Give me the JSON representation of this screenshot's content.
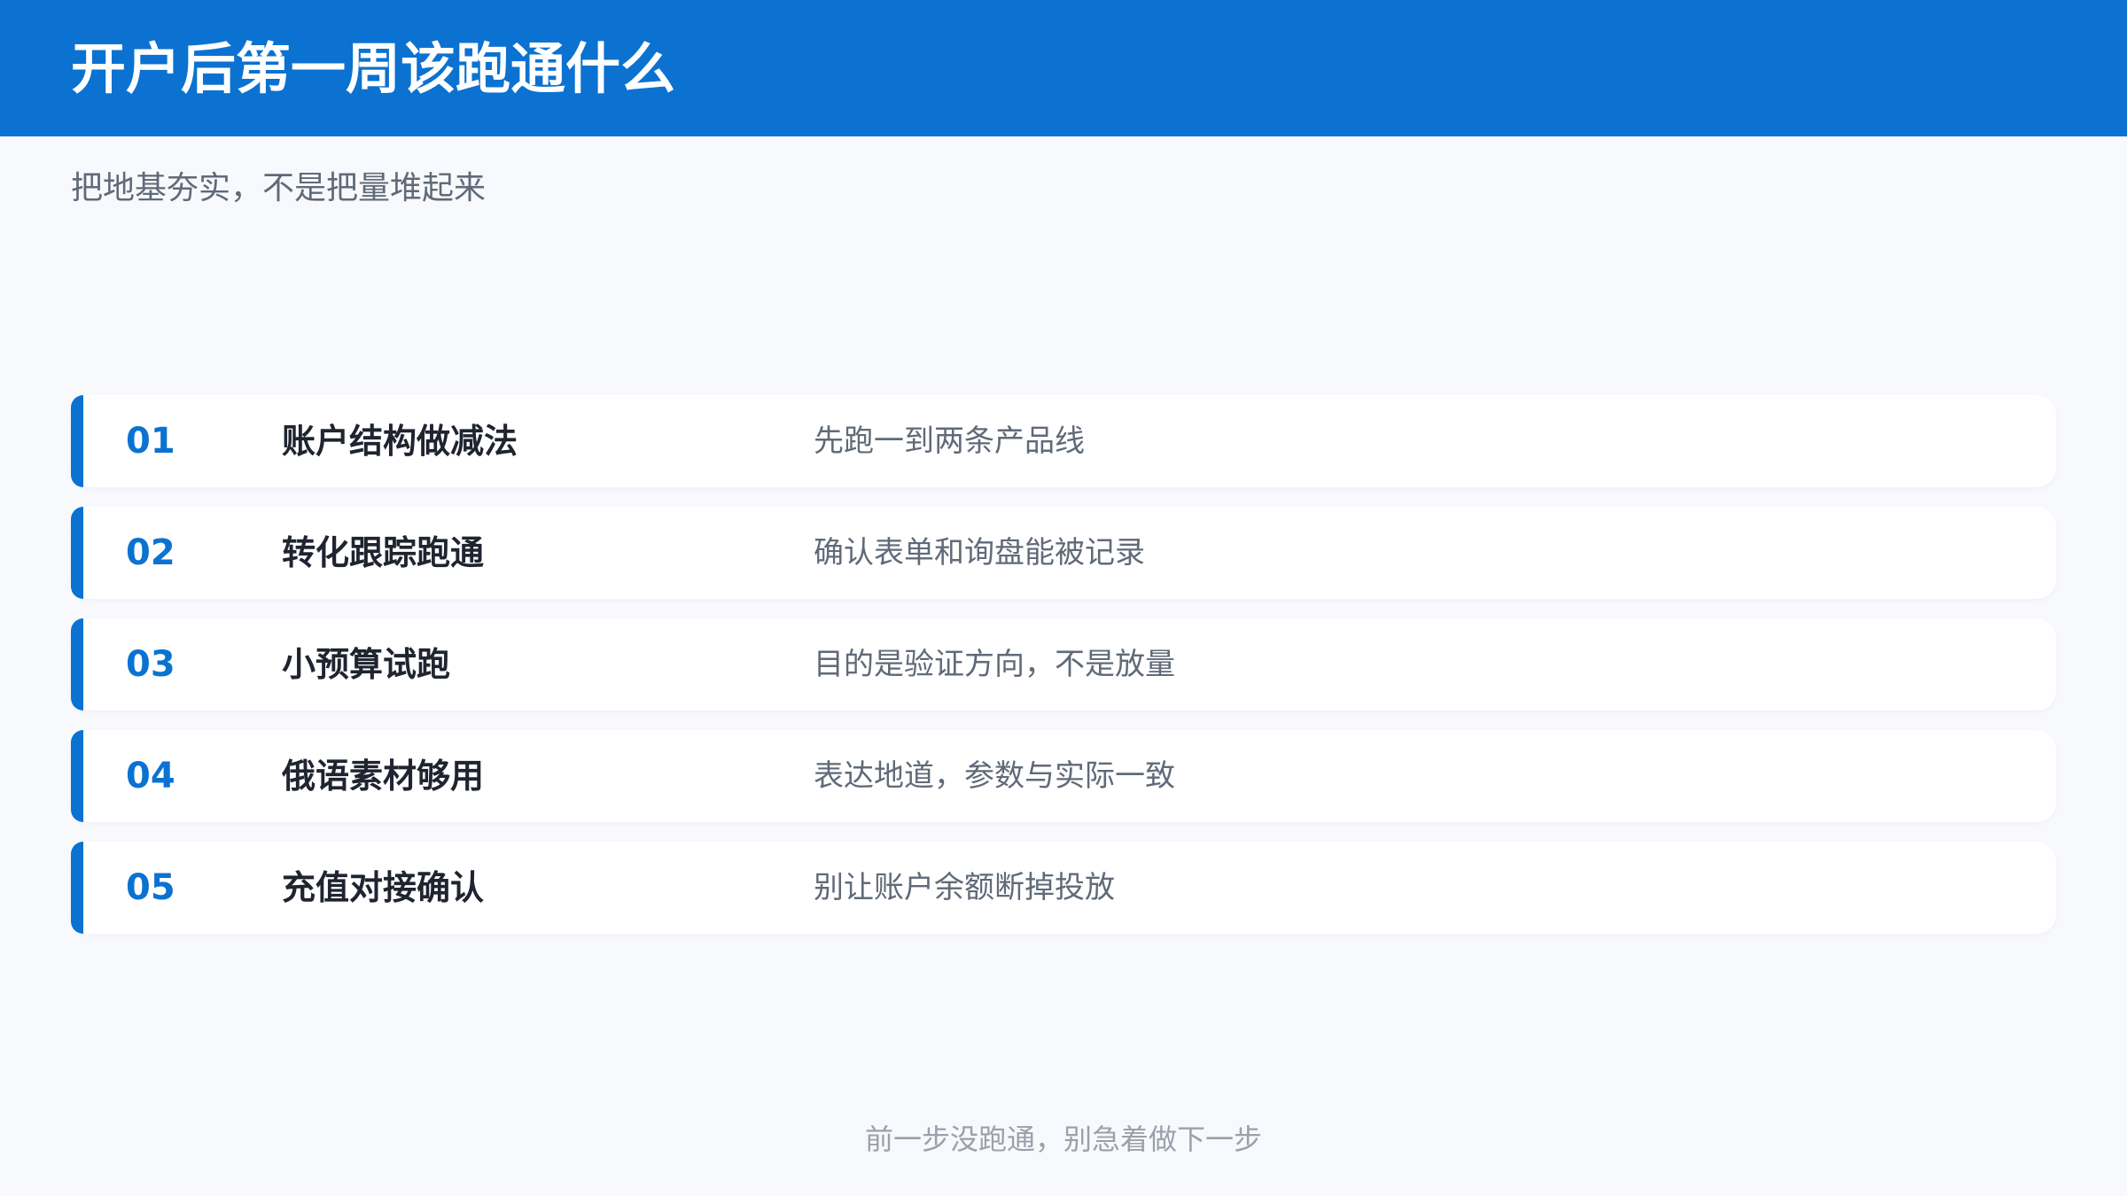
{
  "header": {
    "title": "开户后第一周该跑通什么",
    "accent_color": "#0b72d1"
  },
  "subtitle": "把地基夯实，不是把量堆起来",
  "items": [
    {
      "num": "01",
      "name": "账户结构做减法",
      "desc": "先跑一到两条产品线"
    },
    {
      "num": "02",
      "name": "转化跟踪跑通",
      "desc": "确认表单和询盘能被记录"
    },
    {
      "num": "03",
      "name": "小预算试跑",
      "desc": "目的是验证方向，不是放量"
    },
    {
      "num": "04",
      "name": "俄语素材够用",
      "desc": "表达地道，参数与实际一致"
    },
    {
      "num": "05",
      "name": "充值对接确认",
      "desc": "别让账户余额断掉投放"
    }
  ],
  "footer": "前一步没跑通，别急着做下一步"
}
